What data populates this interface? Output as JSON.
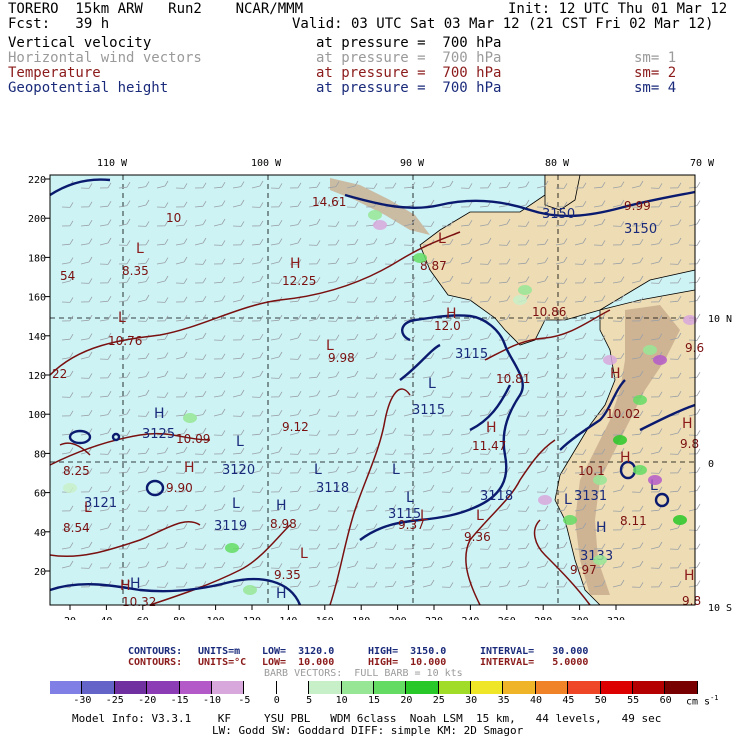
{
  "header": {
    "line1_left": "TORERO  15km ARW   Run2    NCAR/MMM",
    "line1_right": "Init: 12 UTC Thu 01 Mar 12",
    "line2_left": "Fcst:   39 h",
    "line2_right": "Valid: 03 UTC Sat 03 Mar 12 (21 CST Fri 02 Mar 12)",
    "fields": [
      {
        "name": "Vertical velocity",
        "pressure": "at pressure =  700 hPa",
        "sm": "",
        "color": "#000000"
      },
      {
        "name": "Horizontal wind vectors",
        "pressure": "at pressure =  700 hPa",
        "sm": "sm= 1",
        "color": "#9a9a9a"
      },
      {
        "name": "Temperature",
        "pressure": "at pressure =  700 hPa",
        "sm": "sm= 2",
        "color": "#8b1a1a"
      },
      {
        "name": "Geopotential height",
        "pressure": "at pressure =  700 hPa",
        "sm": "sm= 4",
        "color": "#1a2a7a"
      }
    ]
  },
  "map": {
    "lon_labels": [
      "110 W",
      "100 W",
      "90 W",
      "80 W",
      "70 W"
    ],
    "lat_labels": [
      "10 N",
      "0",
      "10 S"
    ],
    "x_ticks": [
      "20",
      "40",
      "60",
      "80",
      "100",
      "120",
      "140",
      "160",
      "180",
      "200",
      "220",
      "240",
      "260",
      "280",
      "300",
      "320"
    ],
    "y_ticks": [
      "20",
      "40",
      "60",
      "80",
      "100",
      "120",
      "140",
      "160",
      "180",
      "200",
      "220"
    ],
    "colors": {
      "ocean": "#cdf3f5",
      "land": "#eedcb4",
      "mountain": "#c9ad8e",
      "height": "#0a1a6e",
      "temp": "#7a1010",
      "barb": "#9aa0a6"
    },
    "height_labels": [
      "3150",
      "3150",
      "3115",
      "3115",
      "3125",
      "3120",
      "3118",
      "3115",
      "3118",
      "3121",
      "3119",
      "3131",
      "3133"
    ],
    "temp_labels": [
      "14.61",
      "10",
      "8.35",
      "12.25",
      "54",
      "10.76",
      "9.98",
      "12.0",
      "10.86",
      "9.99",
      "10.81",
      "22",
      "9.12",
      "10.09",
      "11.47",
      "10.02",
      "9.8",
      "8.25",
      "9.90",
      "8.98",
      "9.36",
      "9.37",
      "9.35",
      "8.54",
      "10.32",
      "8.11",
      "9.97",
      "10.1",
      "9.8",
      "8.87",
      "9.6"
    ],
    "high_low_letters": [
      "L",
      "H",
      "L",
      "H",
      "L",
      "H",
      "L",
      "L",
      "L",
      "H",
      "H",
      "L",
      "H",
      "H",
      "L",
      "L",
      "H",
      "L",
      "H",
      "L",
      "H",
      "L",
      "L",
      "H",
      "H",
      "L",
      "L",
      "H",
      "H",
      "L"
    ]
  },
  "footer": {
    "contours1_label": "CONTOURS:",
    "contours1_units": "UNITS=m",
    "contours1_low": "LOW=  3120.0",
    "contours1_high": "HIGH=  3150.0",
    "contours1_interval": "INTERVAL=   30.000",
    "contours2_label": "CONTOURS:",
    "contours2_units": "UNITS=°C",
    "contours2_low": "LOW=  10.000",
    "contours2_high": "HIGH=  10.000",
    "contours2_interval": "INTERVAL=   5.0000",
    "barb_line": "BARB VECTORS:  FULL BARB = 10 kts",
    "colorbar_ticks": [
      "-30",
      "-25",
      "-20",
      "-15",
      "-10",
      "-5",
      "0",
      "5",
      "10",
      "15",
      "20",
      "25",
      "30",
      "35",
      "40",
      "45",
      "50",
      "55",
      "60"
    ],
    "colorbar_units": "cm s",
    "colorbar_colors": [
      "#7f7fe6",
      "#6464c8",
      "#7030a0",
      "#8c3cb4",
      "#b45ac8",
      "#d8a8dc",
      "#ffffff",
      "#ffffff",
      "#c8f0c8",
      "#96e696",
      "#64dc64",
      "#28c828",
      "#a0dc28",
      "#f0e628",
      "#f0b428",
      "#f08228",
      "#f04628",
      "#dc0000",
      "#b40000",
      "#780000"
    ],
    "model_info": "Model Info: V3.3.1    KF     YSU PBL   WDM 6class  Noah LSM  15 km,   44 levels,   49 sec",
    "model_info2": "LW: Godd SW: Goddard DIFF: simple KM: 2D Smagor"
  }
}
